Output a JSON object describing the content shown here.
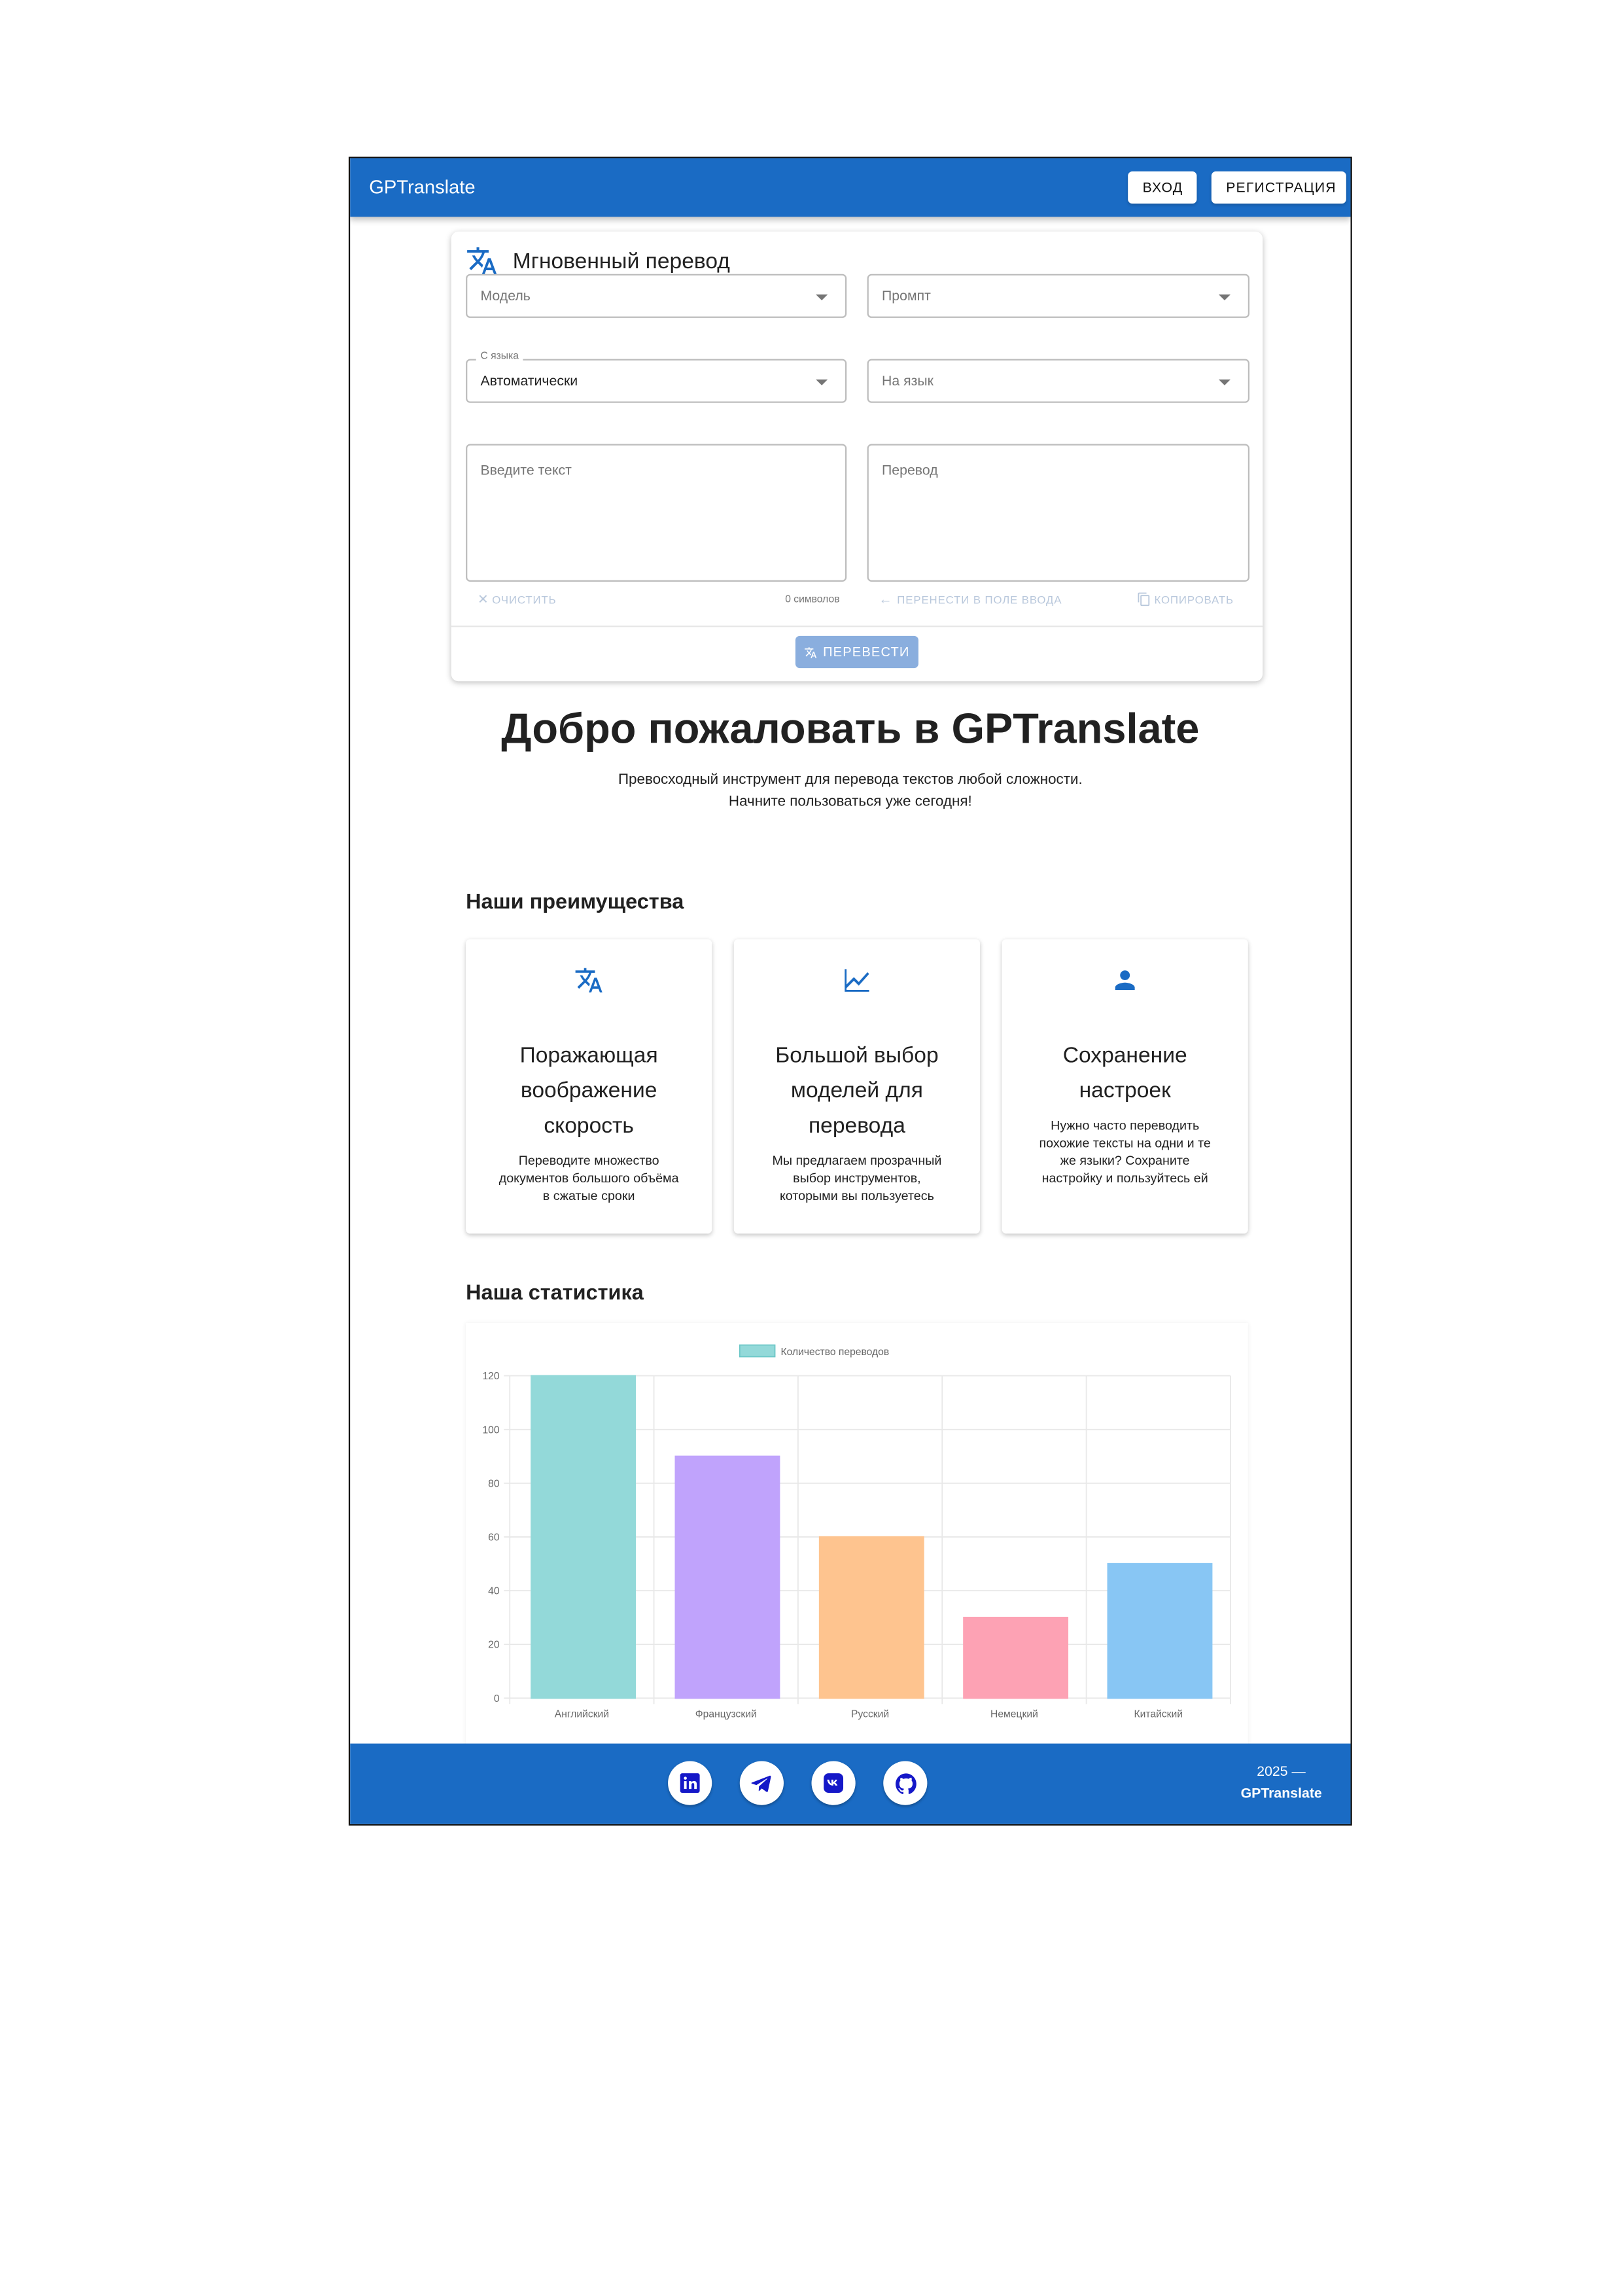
{
  "appbar": {
    "brand": "GPTranslate",
    "login_label": "ВХОД",
    "register_label": "РЕГИСТРАЦИЯ"
  },
  "translator": {
    "title": "Мгновенный перевод",
    "model_label": "Модель",
    "prompt_label": "Промпт",
    "source_lang_label": "С языка",
    "source_lang_value": "Автоматически",
    "target_lang_label": "На язык",
    "input_placeholder": "Введите текст",
    "output_placeholder": "Перевод",
    "clear_label": "ОЧИСТИТЬ",
    "char_count": "0 символов",
    "move_to_input_label": "ПЕРЕНЕСТИ В ПОЛЕ ВВОДА",
    "copy_label": "КОПИРОВАТЬ",
    "translate_label": "ПЕРЕВЕСТИ"
  },
  "hero": {
    "title": "Добро пожаловать в GPTranslate",
    "subtitle_line1": "Превосходный инструмент для перевода текстов любой сложности.",
    "subtitle_line2": "Начните пользоваться уже сегодня!"
  },
  "advantages": {
    "heading": "Наши преимущества",
    "items": [
      {
        "icon": "translate-icon",
        "title_lines": [
          "Поражающая",
          "воображение",
          "скорость"
        ],
        "desc_lines": [
          "Переводите множество",
          "документов большого объёма",
          "в сжатые сроки"
        ]
      },
      {
        "icon": "chart-line-icon",
        "title_lines": [
          "Большой выбор",
          "моделей для",
          "перевода"
        ],
        "desc_lines": [
          "Мы предлагаем прозрачный",
          "выбор инструментов,",
          "которыми вы пользуетесь"
        ]
      },
      {
        "icon": "person-icon",
        "title_lines": [
          "Сохранение",
          "настроек"
        ],
        "desc_lines": [
          "Нужно часто переводить",
          "похожие тексты на одни и те",
          "же языки? Сохраните",
          "настройку и пользуйтесь ей"
        ]
      }
    ]
  },
  "stats": {
    "heading": "Наша статистика"
  },
  "chart_data": {
    "type": "bar",
    "categories": [
      "Английский",
      "Французский",
      "Русский",
      "Немецкий",
      "Китайский"
    ],
    "series": [
      {
        "name": "Количество переводов",
        "values": [
          120,
          90,
          60,
          30,
          50
        ]
      }
    ],
    "ylim": [
      0,
      120
    ],
    "yticks": [
      0,
      20,
      40,
      60,
      80,
      100,
      120
    ],
    "colors": [
      "#93d9d9",
      "#c0a3fc",
      "#fec48f",
      "#fda2b4",
      "#88c6f4"
    ],
    "legend": "top",
    "grid": true
  },
  "footer": {
    "social": [
      "linkedin-icon",
      "telegram-icon",
      "vk-icon",
      "github-icon"
    ],
    "year": "2025 —",
    "brand": "GPTranslate"
  },
  "colors": {
    "primary": "#1a6bc4",
    "translate_button_disabled": "#8aaede"
  }
}
